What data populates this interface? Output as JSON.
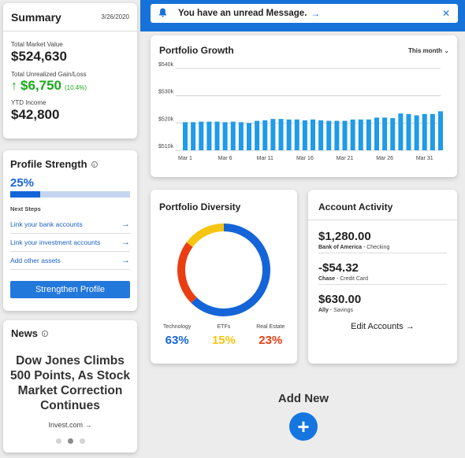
{
  "summary": {
    "title": "Summary",
    "date": "3/26/2020",
    "total_market_value_label": "Total Market Value",
    "total_market_value": "$524,630",
    "unrealized_label": "Total Unrealized Gain/Loss",
    "unrealized_value": "$6,750",
    "unrealized_pct": "(10.4%)",
    "ytd_label": "YTD Income",
    "ytd_value": "$42,800"
  },
  "profile": {
    "title": "Profile Strength",
    "percent_text": "25%",
    "progress": 0.25,
    "next_steps_label": "Next Steps",
    "steps": [
      {
        "label": "Link your bank accounts"
      },
      {
        "label": "Link your investment accounts"
      },
      {
        "label": "Add other assets"
      }
    ],
    "button_label": "Strengthen Profile"
  },
  "news": {
    "title": "News",
    "headline": "Dow Jones Climbs 500 Points, As Stock Market Correction Continues",
    "source": "Invest.com →",
    "active_dot": 1
  },
  "message": {
    "text": "You have an unread Message."
  },
  "growth": {
    "title": "Portfolio Growth",
    "period": "This month"
  },
  "chart_data": {
    "type": "bar",
    "title": "Portfolio Growth",
    "ylim": [
      510,
      540
    ],
    "yticks": [
      "$510k",
      "$520k",
      "$530k",
      "$540k"
    ],
    "xticks": [
      "Mar 1",
      "Mar 6",
      "Mar 11",
      "Mar 16",
      "Mar 21",
      "Mar 26",
      "Mar 31"
    ],
    "values": [
      520.3,
      520.3,
      520.5,
      520.5,
      520.5,
      520.3,
      520.5,
      520.3,
      520.0,
      520.8,
      521.0,
      521.5,
      521.5,
      521.3,
      521.3,
      521.0,
      521.3,
      521.0,
      520.8,
      520.8,
      520.8,
      521.3,
      521.3,
      521.3,
      522.0,
      522.0,
      521.8,
      523.5,
      523.3,
      522.8,
      523.3,
      523.3,
      524.3
    ],
    "color": "#1e9be9"
  },
  "diversity": {
    "title": "Portfolio Diversity",
    "items": [
      {
        "name": "Technology",
        "value": "63%",
        "pct": 63,
        "color": "#1565d8"
      },
      {
        "name": "ETFs",
        "value": "15%",
        "pct": 15,
        "color": "#f5c511"
      },
      {
        "name": "Real Estate",
        "value": "23%",
        "pct": 23,
        "color": "#ea3e12"
      }
    ]
  },
  "activity": {
    "title": "Account Activity",
    "items": [
      {
        "amount": "$1,280.00",
        "source": "Bank of America",
        "type": "Checking"
      },
      {
        "amount": "-$54.32",
        "source": "Chase",
        "type": "Credit Card"
      },
      {
        "amount": "$630.00",
        "source": "Ally",
        "type": "Savings"
      }
    ],
    "edit_label": "Edit Accounts →"
  },
  "add_new": {
    "label": "Add New"
  }
}
